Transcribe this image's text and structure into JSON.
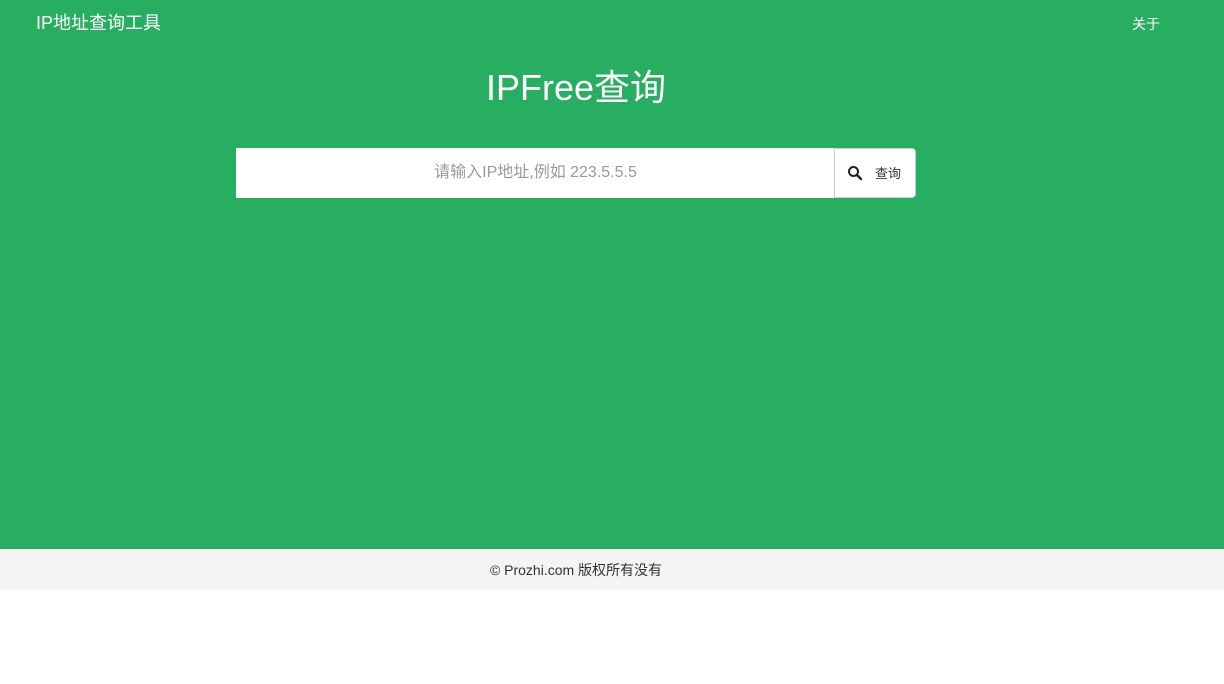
{
  "navbar": {
    "brand": "IP地址查询工具",
    "about_label": "关于"
  },
  "hero": {
    "title": "IPFree查询"
  },
  "search": {
    "placeholder": "请输入IP地址,例如 223.5.5.5",
    "value": "",
    "button_label": "查询",
    "button_icon": "search-icon"
  },
  "footer": {
    "copyright": "© Prozhi.com 版权所有没有"
  },
  "colors": {
    "primary": "#27ae60",
    "footer_bg": "#f4f4f4",
    "text_light": "#ffffff"
  }
}
